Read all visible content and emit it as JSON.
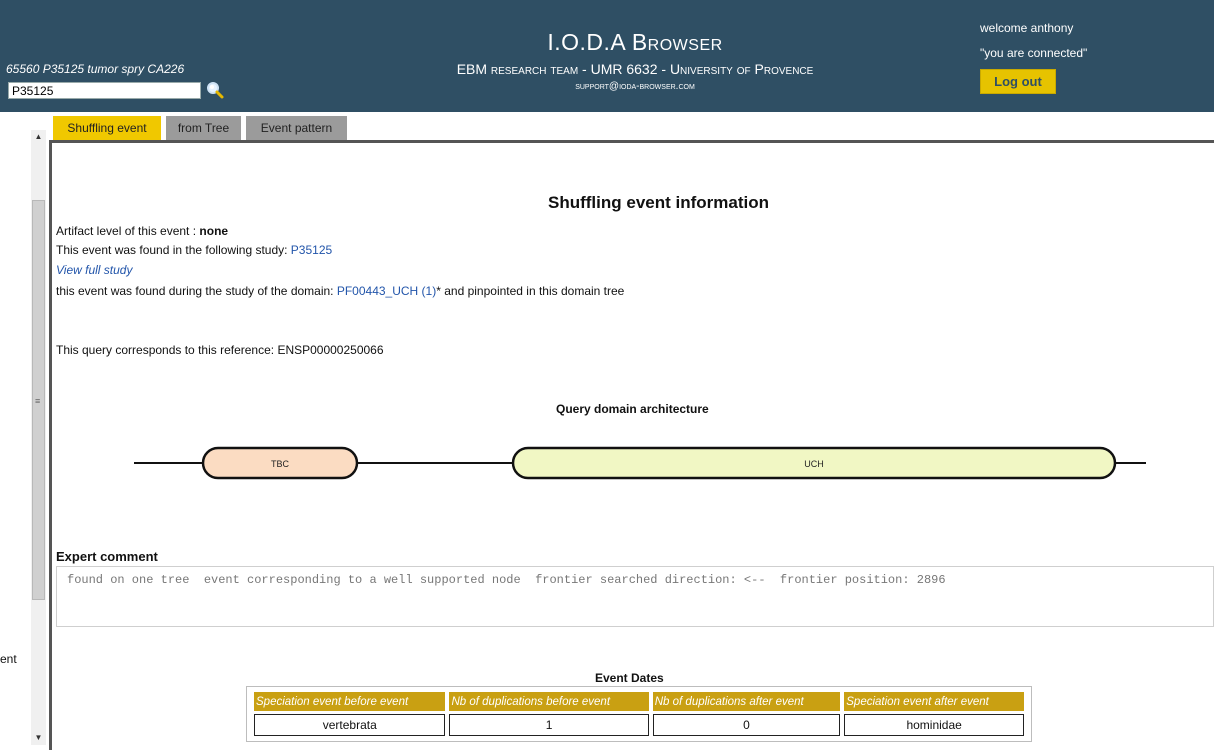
{
  "header": {
    "study_line": "65560 P35125 tumor spry CA226",
    "search_value": "P35125",
    "title": "I.O.D.A Browser",
    "subtitle": "EBM research team - UMR 6632 - University of Provence",
    "email": "support@ioda-browser.com",
    "welcome": "welcome anthony",
    "connected": "\"you are connected\"",
    "logout_label": "Log out"
  },
  "left_fragment": "ent",
  "tabs": [
    {
      "label": "Shuffling event",
      "active": true
    },
    {
      "label": "from Tree",
      "active": false
    },
    {
      "label": "Event pattern",
      "active": false
    }
  ],
  "info": {
    "title": "Shuffling event information",
    "artifact_prefix": "Artifact level of this event : ",
    "artifact_value": "none",
    "study_prefix": "This event was found in the following study: ",
    "study_link": "P35125",
    "view_full": "View full study",
    "domain_prefix": "this event was found during the study of the domain: ",
    "domain_link": "PF00443_UCH (1)",
    "domain_suffix": "* and pinpointed in this domain tree",
    "query_text": "This query corresponds to this reference: ENSP00000250066"
  },
  "architecture": {
    "title": "Query domain architecture",
    "domains": [
      {
        "label": "TBC",
        "color": "#fbdcc2"
      },
      {
        "label": "UCH",
        "color": "#f1f7c4"
      }
    ]
  },
  "expert": {
    "label": "Expert comment",
    "comment": "found on one tree  event corresponding to a well supported node  frontier searched direction: <--  frontier position: 2896"
  },
  "event_dates": {
    "title": "Event Dates",
    "headers": [
      "Speciation event before event",
      "Nb of duplications before event",
      "Nb of duplications after event",
      "Speciation event after event"
    ],
    "row": [
      "vertebrata",
      "1",
      "0",
      "hominidae"
    ]
  },
  "colors": {
    "header_bg": "#2f4f64",
    "accent_yellow": "#f0c800",
    "table_header": "#c9a012",
    "link": "#2255aa"
  }
}
